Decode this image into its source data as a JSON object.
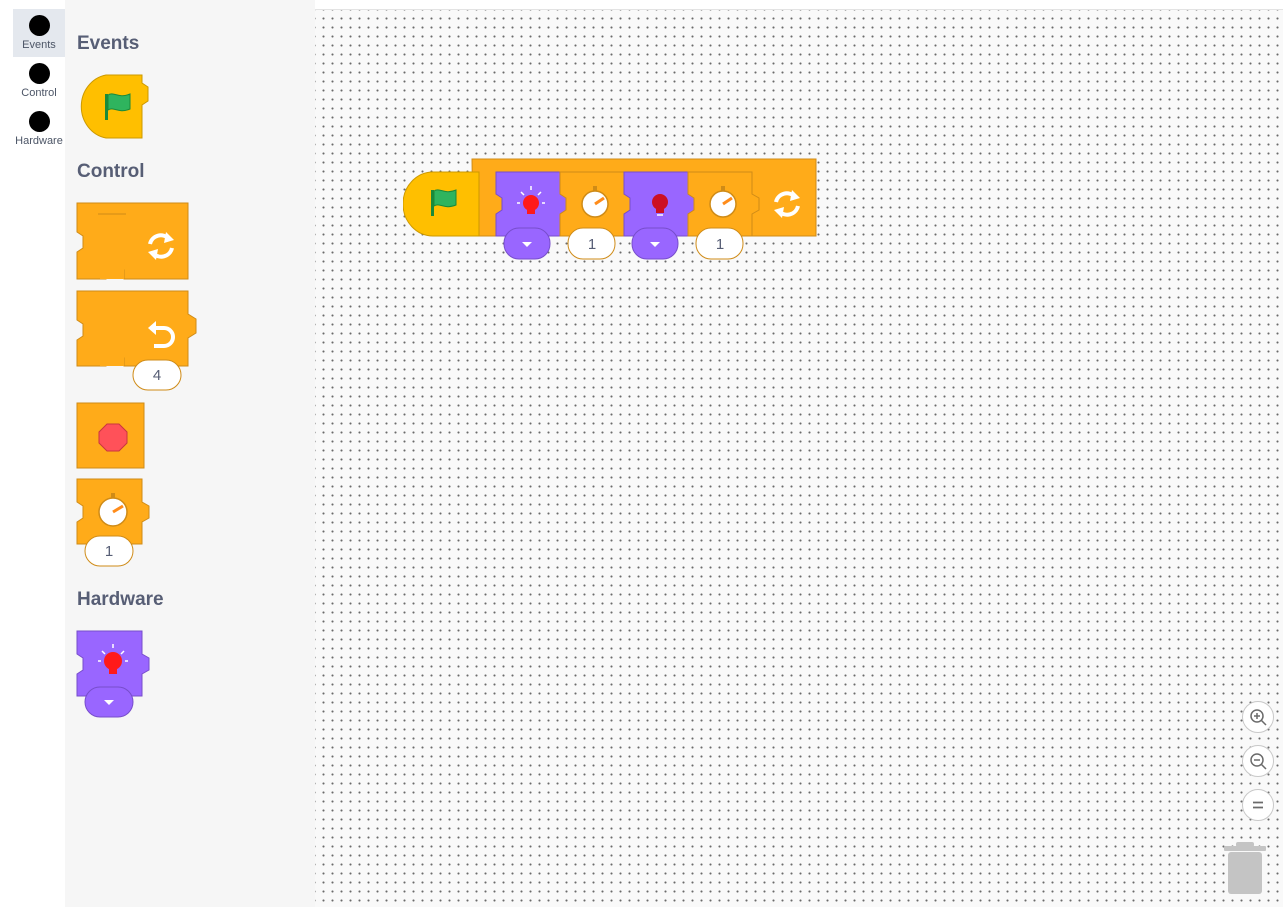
{
  "categories": [
    {
      "label": "Events",
      "selected": true
    },
    {
      "label": "Control",
      "selected": false
    },
    {
      "label": "Hardware",
      "selected": false
    }
  ],
  "flyout": {
    "events_heading": "Events",
    "control_heading": "Control",
    "hardware_heading": "Hardware",
    "repeat_count": "4",
    "wait_seconds": "1"
  },
  "workspace": {
    "script": {
      "wait1_seconds": "1",
      "wait2_seconds": "1"
    }
  },
  "zoom_controls": [
    "zoom-in-icon",
    "zoom-out-icon",
    "zoom-reset-icon"
  ],
  "colors": {
    "control_orange": "#ffab19",
    "events_yellow": "#ffbf00",
    "hardware_purple": "#9966ff",
    "flag_green": "#2fb45e",
    "light_red": "#ff1a1a"
  }
}
